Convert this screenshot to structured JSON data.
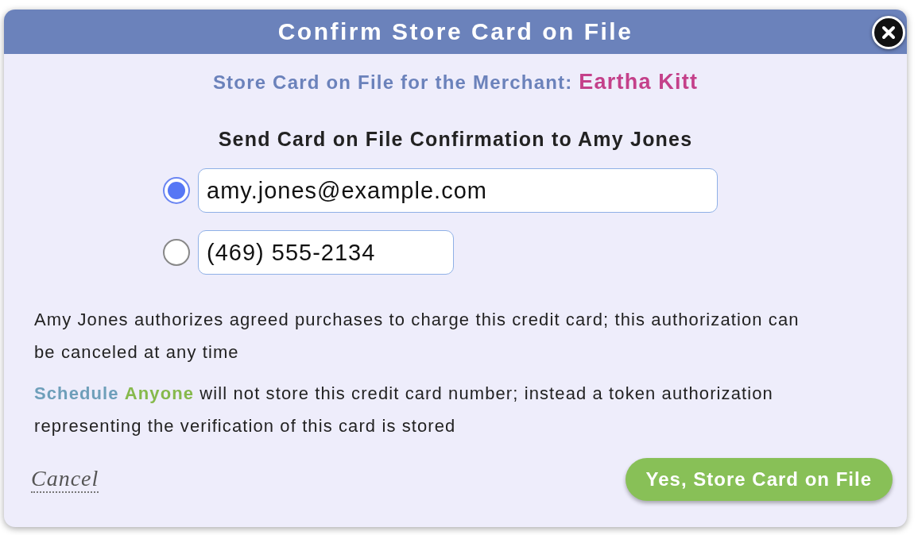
{
  "dialog": {
    "title": "Confirm Store Card on File"
  },
  "merchant": {
    "label": "Store Card on File for the Merchant:",
    "name": "Eartha Kitt"
  },
  "heading": "Send Card on File Confirmation to Amy Jones",
  "options": [
    {
      "kind": "email",
      "value": "amy.jones@example.com",
      "selected": true
    },
    {
      "kind": "phone",
      "value": "(469) 555-2134",
      "selected": false
    }
  ],
  "authorization": "Amy Jones authorizes agreed purchases to charge this credit card; this authorization can be canceled at any time",
  "notice": {
    "brand_first": "Schedule",
    "brand_second": "Anyone",
    "text": "will not store this credit card number; instead a token authorization representing the verification of this card is stored"
  },
  "cancel": "Cancel",
  "confirm": "Yes, Store Card on File"
}
